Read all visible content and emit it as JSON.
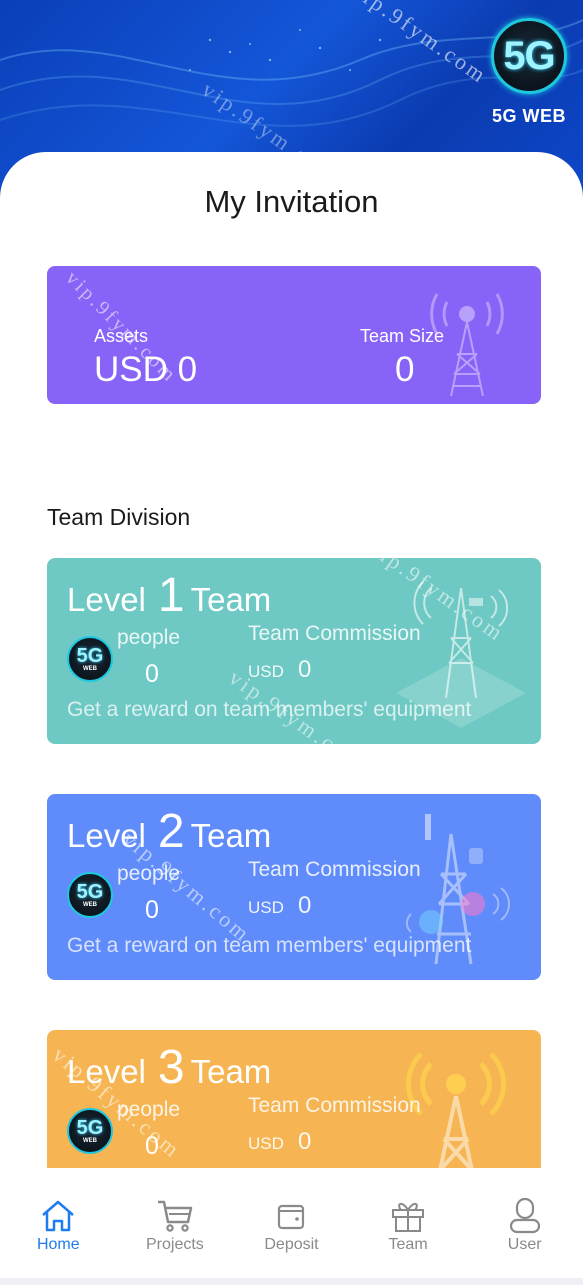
{
  "brand": {
    "logo_main": "5G",
    "logo_sub": "5G WEB"
  },
  "page_title": "My Invitation",
  "summary": {
    "assets_label": "Assets",
    "assets_value": "USD 0",
    "team_size_label": "Team Size",
    "team_size_value": "0"
  },
  "section_title": "Team Division",
  "levels": [
    {
      "word_level": "Level",
      "number": "1",
      "word_team": "Team",
      "people_label": "people",
      "people_value": "0",
      "commission_label": "Team Commission",
      "currency": "USD",
      "commission_value": "0",
      "description": "Get a reward on team members' equipment",
      "color": "#6ec8c3"
    },
    {
      "word_level": "Level",
      "number": "2",
      "word_team": "Team",
      "people_label": "people",
      "people_value": "0",
      "commission_label": "Team Commission",
      "currency": "USD",
      "commission_value": "0",
      "description": "Get a reward on team members' equipment",
      "color": "#5f8cfa"
    },
    {
      "word_level": "Level",
      "number": "3",
      "word_team": "Team",
      "people_label": "people",
      "people_value": "0",
      "commission_label": "Team Commission",
      "currency": "USD",
      "commission_value": "0",
      "description": "",
      "color": "#f6b552"
    }
  ],
  "avatar": {
    "main": "5G",
    "sub": "WEB"
  },
  "watermark": "vip.9fym.com",
  "nav": [
    {
      "label": "Home",
      "icon": "home-icon",
      "active": true
    },
    {
      "label": "Projects",
      "icon": "cart-icon",
      "active": false
    },
    {
      "label": "Deposit",
      "icon": "wallet-icon",
      "active": false
    },
    {
      "label": "Team",
      "icon": "gift-icon",
      "active": false
    },
    {
      "label": "User",
      "icon": "user-icon",
      "active": false
    }
  ],
  "colors": {
    "accent": "#1d7df0",
    "header_blue": "#0d47c9",
    "summary_purple": "#8863f7"
  }
}
